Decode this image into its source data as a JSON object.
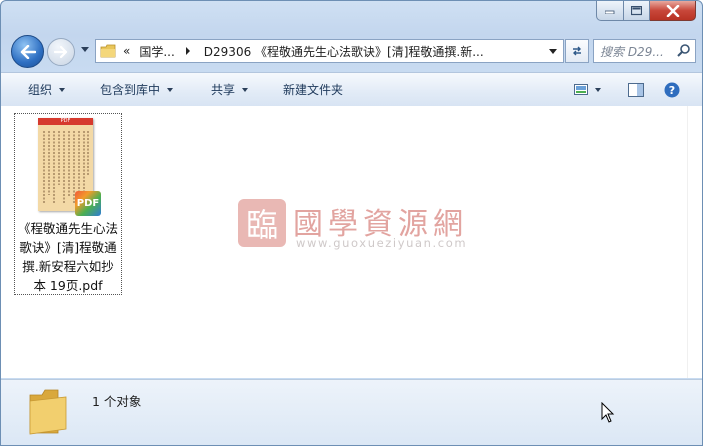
{
  "window": {
    "caption_buttons": {
      "minimize": "minimize",
      "maximize": "maximize",
      "close": "close"
    }
  },
  "navigation": {
    "breadcrumb": {
      "overflow": "«",
      "parent": "国学...",
      "current": "D29306 《程敬通先生心法歌诀》[清]程敬通撰.新..."
    },
    "search_placeholder": "搜索 D29..."
  },
  "toolbar": {
    "organize": "组织",
    "include_library": "包含到库中",
    "share": "共享",
    "new_folder": "新建文件夹"
  },
  "files": [
    {
      "name_lines": [
        "《程敬通先生心法",
        "歌诀》[清]程敬通",
        "撰.新安程六如抄",
        "本 19页.pdf"
      ],
      "type_badge": "PDF",
      "thumb_header": "PDF"
    }
  ],
  "watermark": {
    "seal": "臨",
    "title": "國學資源網",
    "url": "www.guoxueziyuan.com"
  },
  "status": {
    "count_text": "1 个对象"
  },
  "colors": {
    "titlebar": "#c3d6ee",
    "close_button": "#c8473a",
    "watermark_title": "#e2a4a0"
  }
}
